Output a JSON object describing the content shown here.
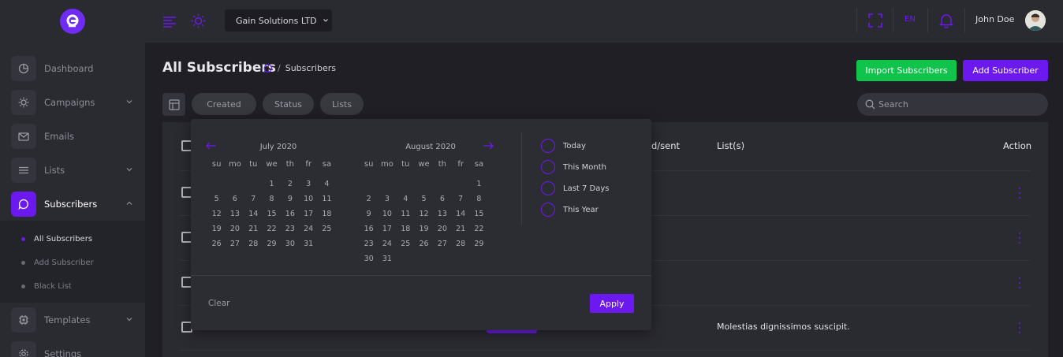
{
  "colors": {
    "accent": "#6c19f0",
    "success": "#10c44b",
    "background": "#1f1f25",
    "panel": "#2a2a31"
  },
  "sidebar": {
    "logo_icon": "app-logo",
    "items": [
      {
        "label": "Dashboard",
        "icon": "pie-chart-icon"
      },
      {
        "label": "Campaigns",
        "icon": "sun-icon"
      },
      {
        "label": "Emails",
        "icon": "mail-icon"
      },
      {
        "label": "Lists",
        "icon": "list-icon"
      },
      {
        "label": "Subscribers",
        "icon": "chat-icon"
      },
      {
        "label": "Templates",
        "icon": "cpu-icon"
      },
      {
        "label": "Settings",
        "icon": "gear-icon"
      }
    ],
    "subitems": [
      {
        "label": "All Subscribers"
      },
      {
        "label": "Add Subscriber"
      },
      {
        "label": "Black List"
      }
    ]
  },
  "topbar": {
    "company": "Gain Solutions LTD",
    "language": "EN",
    "user_name": "John Doe"
  },
  "page": {
    "title": "All Subscribers",
    "breadcrumb_current": "Subscribers",
    "import_button": "Import Subscribers",
    "add_button": "Add Subscriber"
  },
  "filters": {
    "chips": [
      "Created",
      "Status",
      "Lists"
    ],
    "search_placeholder": "Search"
  },
  "table": {
    "headers": {
      "sent": "d/sent",
      "lists": "List(s)",
      "action": "Action"
    },
    "visible_list_cell": "Molestias dignissimos suscipit."
  },
  "datepicker": {
    "left_month": "July 2020",
    "right_month": "August 2020",
    "weekdays": [
      "su",
      "mo",
      "tu",
      "we",
      "th",
      "fr",
      "sa"
    ],
    "left_days": [
      "",
      "",
      "",
      "1",
      "2",
      "3",
      "4",
      "5",
      "6",
      "7",
      "8",
      "9",
      "10",
      "11",
      "12",
      "13",
      "14",
      "15",
      "16",
      "17",
      "18",
      "19",
      "20",
      "21",
      "22",
      "23",
      "24",
      "25",
      "26",
      "27",
      "28",
      "29",
      "30",
      "31"
    ],
    "right_days": [
      "",
      "",
      "",
      "",
      "",
      "",
      "1",
      "2",
      "3",
      "4",
      "5",
      "6",
      "7",
      "8",
      "9",
      "10",
      "11",
      "12",
      "13",
      "14",
      "15",
      "16",
      "17",
      "18",
      "19",
      "20",
      "21",
      "22",
      "23",
      "24",
      "25",
      "26",
      "27",
      "28",
      "29",
      "30",
      "31"
    ],
    "presets": [
      "Today",
      "This Month",
      "Last 7 Days",
      "This Year"
    ],
    "clear_label": "Clear",
    "apply_label": "Apply"
  }
}
